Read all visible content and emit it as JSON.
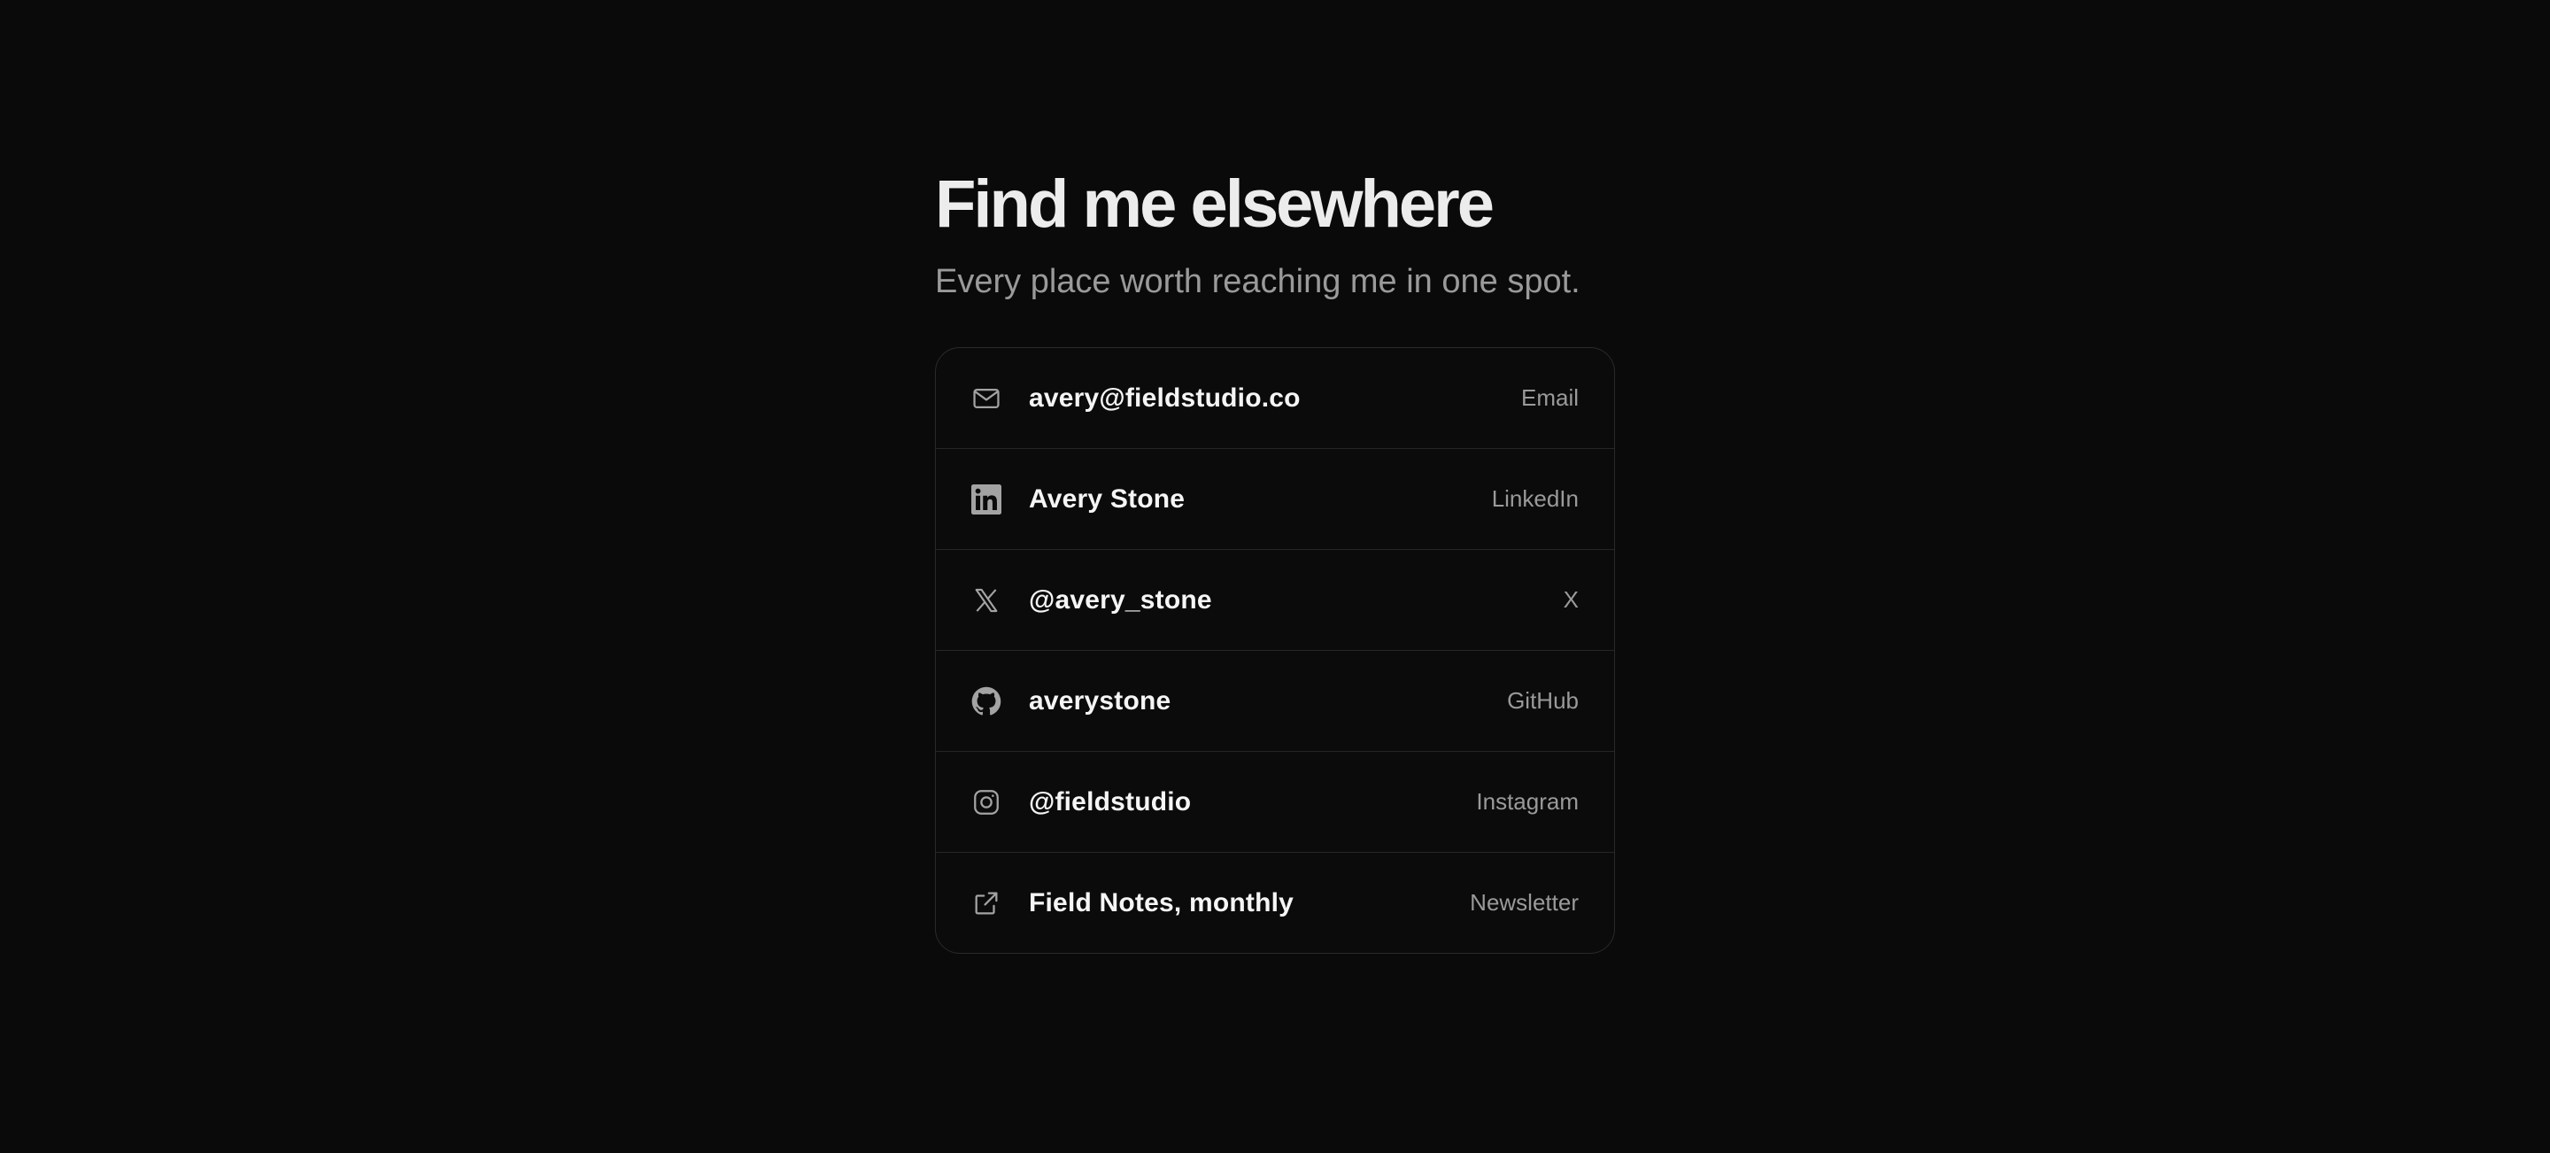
{
  "header": {
    "title": "Find me elsewhere",
    "subtitle": "Every place worth reaching me in one spot."
  },
  "links": [
    {
      "icon": "mail-icon",
      "label": "avery@fieldstudio.co",
      "service": "Email"
    },
    {
      "icon": "linkedin-icon",
      "label": "Avery Stone",
      "service": "LinkedIn"
    },
    {
      "icon": "x-icon",
      "label": "@avery_stone",
      "service": "X"
    },
    {
      "icon": "github-icon",
      "label": "averystone",
      "service": "GitHub"
    },
    {
      "icon": "instagram-icon",
      "label": "@fieldstudio",
      "service": "Instagram"
    },
    {
      "icon": "external-link-icon",
      "label": "Field Notes, monthly",
      "service": "Newsletter"
    }
  ],
  "colors": {
    "background": "#0a0a0a",
    "text": "#f5f5f5",
    "muted": "#9a9a9a",
    "border": "#262626"
  }
}
